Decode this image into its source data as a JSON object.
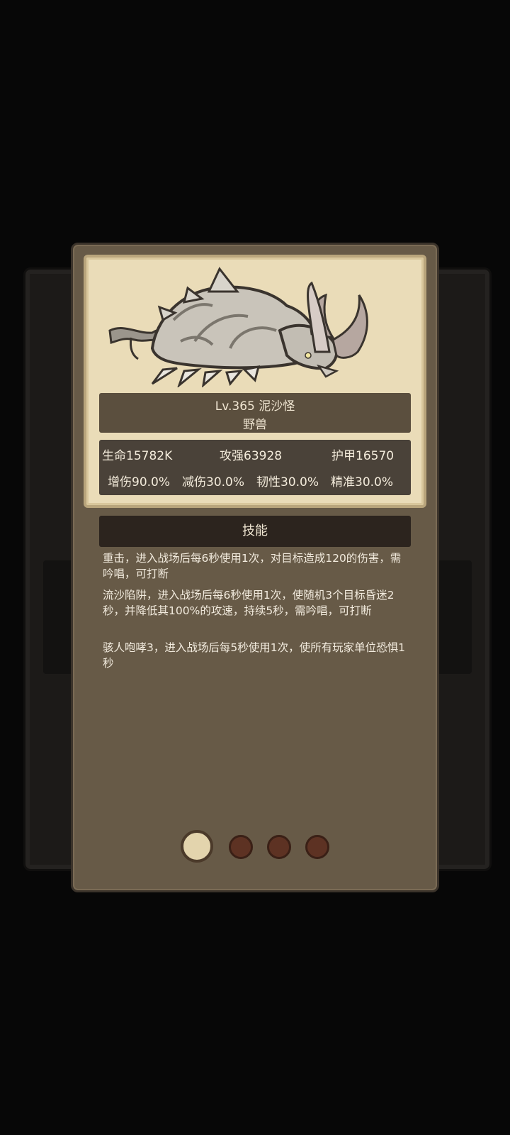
{
  "monster": {
    "title_line": "Lv.365 泥沙怪",
    "category": "野兽",
    "image_icon": "sand-monster-creature-icon"
  },
  "stats": {
    "hp": "生命15782K",
    "attack": "攻强63928",
    "armor": "护甲16570",
    "damage_up": "增伤90.0%",
    "damage_reduce": "减伤30.0%",
    "toughness": "韧性30.0%",
    "accuracy": "精准30.0%"
  },
  "skills": {
    "header": "技能",
    "items": [
      "重击，进入战场后每6秒使用1次，对目标造成120的伤害，需吟唱，可打断",
      "流沙陷阱，进入战场后每6秒使用1次，使随机3个目标昏迷2秒，并降低其100%的攻速，持续5秒，需吟唱，可打断",
      "骇人咆哮3，进入战场后每5秒使用1次，使所有玩家单位恐惧1秒"
    ]
  },
  "pagination": {
    "total": 4,
    "current": 1
  },
  "colors": {
    "card_bg": "#675a47",
    "portrait_bg": "#eadcb8",
    "active_dot": "#e3d4ad",
    "idle_dot": "#5d3223"
  }
}
